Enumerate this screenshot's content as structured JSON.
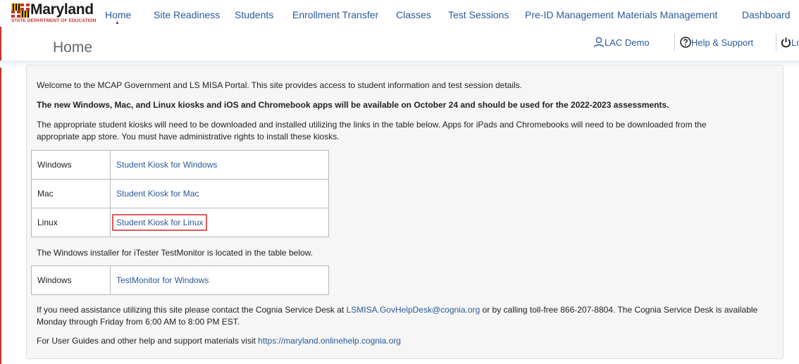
{
  "logo": {
    "name": "Maryland",
    "subtitle": "STATE DEPARTMENT OF EDUCATION"
  },
  "nav": {
    "items": [
      "Home",
      "Site Readiness",
      "Students",
      "Enrollment Transfer",
      "Classes",
      "Test Sessions",
      "Pre-ID Management",
      "Materials Management",
      "Dashboard"
    ],
    "active": "Home"
  },
  "page": {
    "title": "Home"
  },
  "utility": {
    "user": "LAC Demo",
    "help": "Help & Support",
    "logout": "Logou"
  },
  "content": {
    "welcome": "Welcome to the MCAP Government and LS MISA Portal. This site provides access to student information and test session details.",
    "announcement": "The new Windows, Mac, and Linux kiosks and iOS and Chromebook apps will be available on October 24 and should be used for the 2022-2023 assessments.",
    "kiosk_intro_1": "The appropriate student kiosks will need to be downloaded and installed utilizing the links in the table below. Apps for iPads and Chromebooks will need to be downloaded from the",
    "kiosk_intro_2": "appropriate app store. You must have administrative rights to install these kiosks.",
    "kiosk_table": [
      {
        "os": "Windows",
        "link": "Student Kiosk for Windows"
      },
      {
        "os": "Mac",
        "link": "Student Kiosk for Mac"
      },
      {
        "os": "Linux",
        "link": "Student Kiosk for Linux"
      }
    ],
    "monitor_intro": "The Windows installer for iTester TestMonitor is located in the table below.",
    "monitor_table": [
      {
        "os": "Windows",
        "link": "TestMonitor for Windows"
      }
    ],
    "assist_1a": "If you need assistance utilizing this site please contact the Cognia Service Desk at",
    "assist_email": "LSMISA.GovHelpDesk@cognia.org",
    "assist_1b": "or by calling toll-free 866-207-8804. The Cognia Service Desk is available",
    "assist_2": "Monday through Friday from 6:00 AM to 8:00 PM EST.",
    "guides_a": "For User Guides and other help and support materials visit",
    "guides_url": "https://maryland.onlinehelp.cognia.org"
  },
  "colors": {
    "link": "#2a5a9a",
    "highlight": "#e05a5a",
    "panel": "#f6f6f6",
    "accent_red": "#c9302c"
  },
  "icons": [
    "maryland-flag-logo",
    "user-icon",
    "help-icon",
    "power-icon"
  ]
}
